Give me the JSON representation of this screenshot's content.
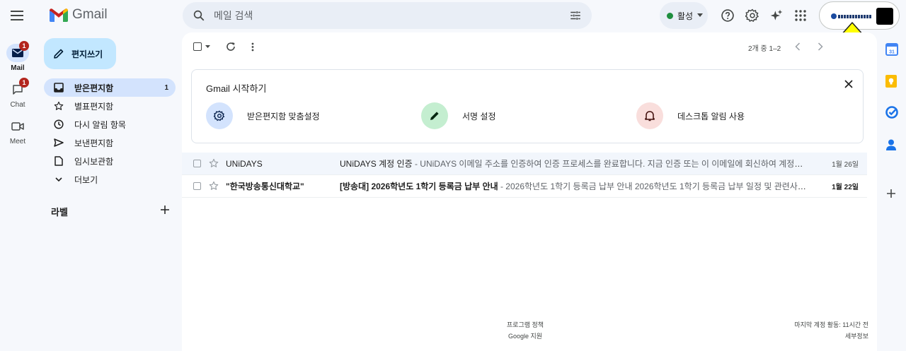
{
  "app": {
    "name": "Gmail"
  },
  "search": {
    "placeholder": "메일 검색"
  },
  "status": {
    "label": "활성",
    "color": "#1e8e3e"
  },
  "rail": {
    "mail": {
      "label": "Mail",
      "badge": "1"
    },
    "chat": {
      "label": "Chat",
      "badge": "1"
    },
    "meet": {
      "label": "Meet"
    }
  },
  "compose": {
    "label": "편지쓰기"
  },
  "nav": {
    "items": [
      {
        "label": "받은편지함",
        "count": "1",
        "icon": "inbox-icon"
      },
      {
        "label": "별표편지함",
        "icon": "star-icon"
      },
      {
        "label": "다시 알림 항목",
        "icon": "clock-icon"
      },
      {
        "label": "보낸편지함",
        "icon": "send-icon"
      },
      {
        "label": "임시보관함",
        "icon": "draft-icon"
      },
      {
        "label": "더보기",
        "icon": "chevron-down-icon"
      }
    ],
    "labels_header": "라벨"
  },
  "toolbar": {
    "pager": "2개 중 1–2"
  },
  "getting_started": {
    "title": "Gmail 시작하기",
    "tasks": [
      {
        "label": "받은편지함 맞춤설정",
        "icon": "gear-icon",
        "color": "#d3e3fd"
      },
      {
        "label": "서명 설정",
        "icon": "pen-icon",
        "color": "#c4eed0"
      },
      {
        "label": "데스크톱 알림 사용",
        "icon": "bell-icon",
        "color": "#f9dedc"
      }
    ]
  },
  "emails": [
    {
      "sender": "UNiDAYS",
      "subject": "UNiDAYS 계정 인증",
      "snippet": " - UNiDAYS 이메일 주소를 인증하여 인증 프로세스를 완료합니다. 지금 인증 또는 이 이메일에 회신하여 계정을 인증할 수...",
      "date": "1월 26일",
      "unread": false
    },
    {
      "sender": "\"한국방송통신대학교\"",
      "subject": "[방송대] 2026학년도 1학기 등록금 납부 안내",
      "snippet": " - 2026학년도 1학기 등록금 납부 안내 2026학년도 1학기 등록금 납부 일정 및 관련사항을 다음...",
      "date": "1월 22일",
      "unread": true
    }
  ],
  "footer": {
    "policy": "프로그램 정책",
    "support": "Google 지원",
    "last_activity": "마지막 계정 활동: 11시간 전",
    "details": "세부정보"
  },
  "colors": {
    "accent": "#0b57d0",
    "compose_bg": "#c2e7ff",
    "selected_bg": "#d3e3fd",
    "annotation_arrow": "#ffff00"
  }
}
